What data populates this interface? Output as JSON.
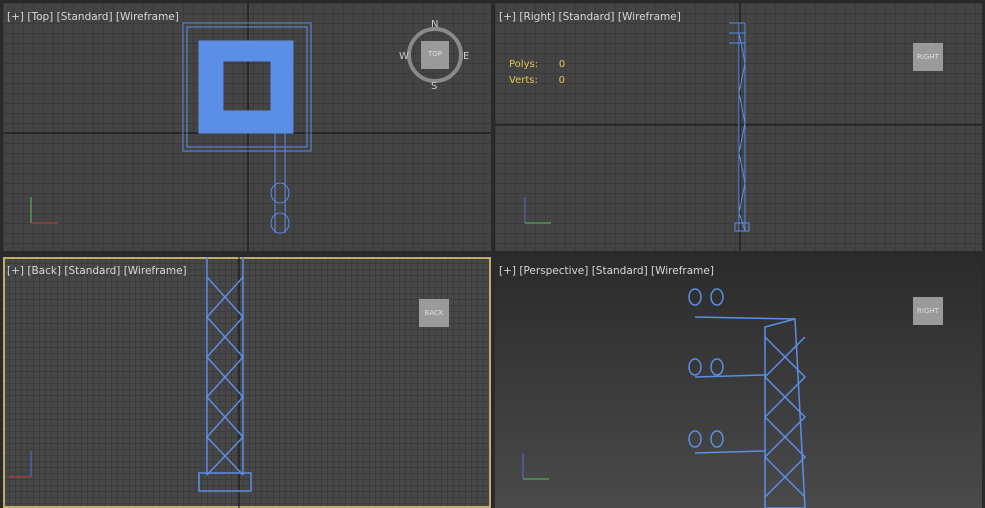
{
  "viewports": {
    "top": {
      "menu": "[+]",
      "view": "[Top]",
      "shading": "[Standard]",
      "mode": "[Wireframe]",
      "compass": {
        "n": "N",
        "s": "S",
        "e": "E",
        "w": "W",
        "cube": "TOP"
      }
    },
    "right": {
      "menu": "[+]",
      "view": "[Right]",
      "shading": "[Standard]",
      "mode": "[Wireframe]",
      "cube": "RIGHT",
      "stats": {
        "polys_label": "Polys:",
        "polys_value": "0",
        "verts_label": "Verts:",
        "verts_value": "0"
      }
    },
    "back": {
      "menu": "[+]",
      "view": "[Back]",
      "shading": "[Standard]",
      "mode": "[Wireframe]",
      "cube": "BACK"
    },
    "perspective": {
      "menu": "[+]",
      "view": "[Perspective]",
      "shading": "[Standard]",
      "mode": "[Wireframe]",
      "cube": "RIGHT"
    }
  },
  "colors": {
    "wire": "#5b8ee6",
    "active_border": "#bfae6a",
    "stats": "#e4c74f"
  }
}
